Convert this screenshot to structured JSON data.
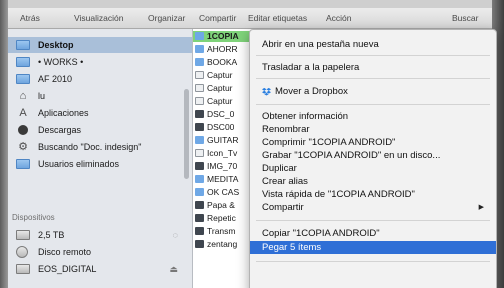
{
  "toolbar": {
    "items": [
      "Atrás",
      "Visualización",
      "Organizar",
      "Compartir",
      "Editar etiquetas",
      "Acción",
      "Buscar"
    ]
  },
  "sidebar": {
    "favorites": [
      {
        "label": "Desktop",
        "icon": "folder-icon",
        "selected": true
      },
      {
        "label": "• WORKS •",
        "icon": "folder-icon"
      },
      {
        "label": "AF 2010",
        "icon": "folder-icon"
      },
      {
        "label": "lu",
        "icon": "home-icon"
      },
      {
        "label": "Aplicaciones",
        "icon": "applications-icon"
      },
      {
        "label": "Descargas",
        "icon": "downloads-icon"
      },
      {
        "label": "Buscando \"Doc. indesign\"",
        "icon": "gear-icon"
      },
      {
        "label": "Usuarios eliminados",
        "icon": "folder-icon"
      }
    ],
    "devices_heading": "Dispositivos",
    "devices": [
      {
        "label": "2,5 TB",
        "icon": "drive-icon"
      },
      {
        "label": "Disco remoto",
        "icon": "remote-disc-icon"
      },
      {
        "label": "EOS_DIGITAL",
        "icon": "drive-icon"
      }
    ]
  },
  "files": [
    {
      "name": "1COPIA",
      "type": "folder",
      "selected": true
    },
    {
      "name": "AHORR",
      "type": "folder"
    },
    {
      "name": "BOOKA",
      "type": "folder"
    },
    {
      "name": "Captur",
      "type": "file"
    },
    {
      "name": "Captur",
      "type": "file"
    },
    {
      "name": "Captur",
      "type": "file"
    },
    {
      "name": "DSC_0",
      "type": "image"
    },
    {
      "name": "DSC00",
      "type": "image"
    },
    {
      "name": "GUITAR",
      "type": "folder"
    },
    {
      "name": "Icon_Tv",
      "type": "file"
    },
    {
      "name": "IMG_70",
      "type": "image"
    },
    {
      "name": "MEDITA",
      "type": "folder"
    },
    {
      "name": "OK CAS",
      "type": "folder"
    },
    {
      "name": "Papa &",
      "type": "image"
    },
    {
      "name": "Repetic",
      "type": "image"
    },
    {
      "name": "Transm",
      "type": "image"
    },
    {
      "name": "zentang",
      "type": "image"
    }
  ],
  "context_menu": {
    "items": [
      "Abrir en una pestaña nueva",
      "Trasladar a la papelera",
      "Mover a Dropbox",
      "Obtener información",
      "Renombrar",
      "Comprimir \"1COPIA ANDROID\"",
      "Grabar \"1COPIA ANDROID\" en un disco...",
      "Duplicar",
      "Crear alias",
      "Vista rápida de \"1COPIA ANDROID\"",
      "Compartir",
      "Copiar \"1COPIA ANDROID\"",
      "Pegar 5 ítems"
    ],
    "highlighted": "Pegar 5 ítems",
    "submenu_arrow": "▶"
  },
  "colors": {
    "selection": "#a9bfd9",
    "menu_highlight": "#2f6fd6",
    "file_selection": "#7fd37a",
    "dropbox": "#2a7fe0"
  }
}
